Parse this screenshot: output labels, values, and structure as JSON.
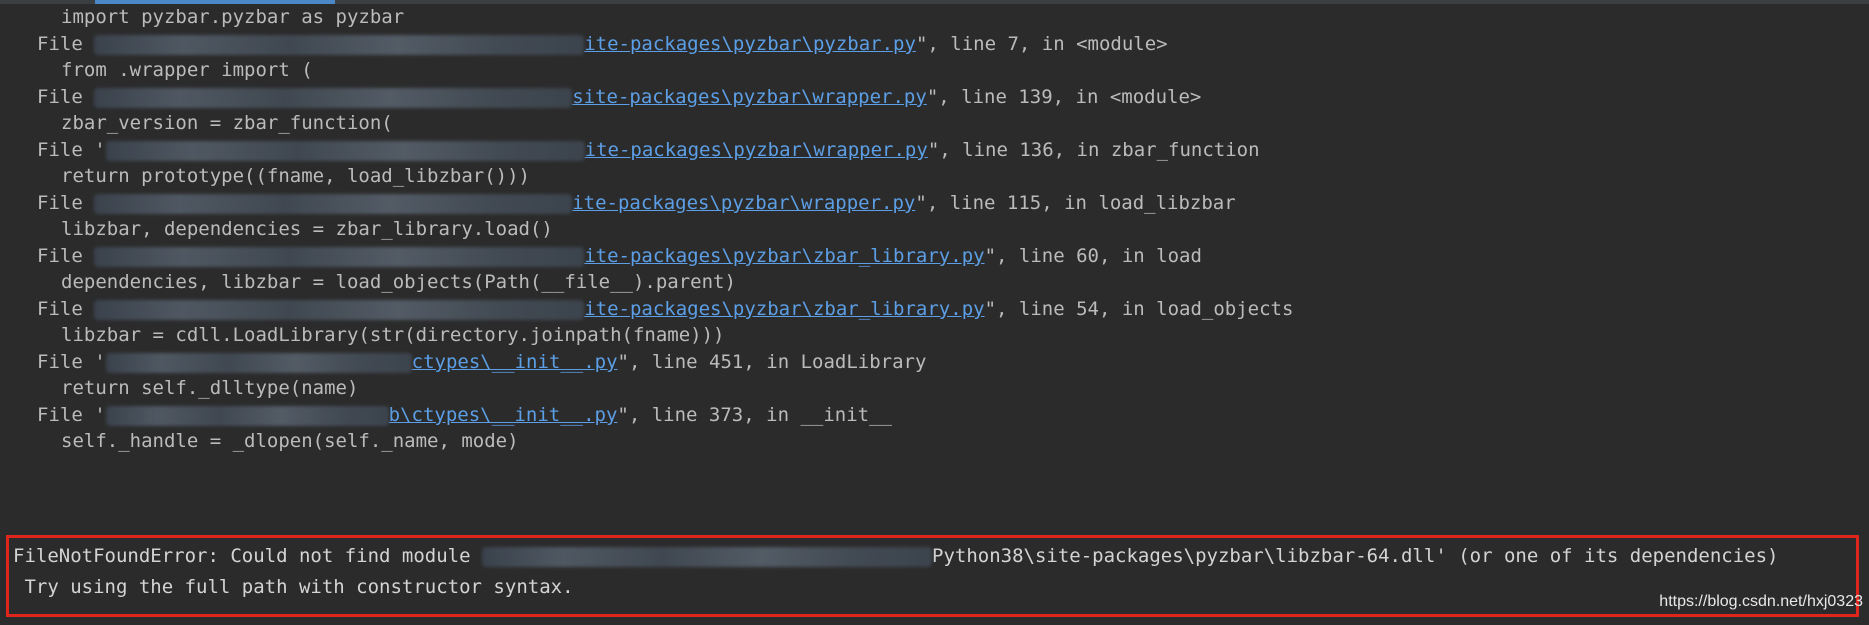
{
  "traceback": {
    "lines": [
      {
        "kind": "code",
        "text": "import pyzbar.pyzbar as pyzbar"
      },
      {
        "kind": "file",
        "prefix": "File ",
        "link": "ite-packages\\pyzbar\\pyzbar.py",
        "suffix": "\", line 7, in <module>"
      },
      {
        "kind": "code",
        "text": "from .wrapper import ("
      },
      {
        "kind": "file",
        "prefix": "File ",
        "link": "site-packages\\pyzbar\\wrapper.py",
        "suffix": "\", line 139, in <module>"
      },
      {
        "kind": "code",
        "text": "zbar_version = zbar_function("
      },
      {
        "kind": "file",
        "prefix": "File '",
        "link": "ite-packages\\pyzbar\\wrapper.py",
        "suffix": "\", line 136, in zbar_function"
      },
      {
        "kind": "code",
        "text": "return prototype((fname, load_libzbar()))"
      },
      {
        "kind": "file",
        "prefix": "File ",
        "link": "ite-packages\\pyzbar\\wrapper.py",
        "suffix": "\", line 115, in load_libzbar"
      },
      {
        "kind": "code",
        "text": "libzbar, dependencies = zbar_library.load()"
      },
      {
        "kind": "file",
        "prefix": "File ",
        "link": "ite-packages\\pyzbar\\zbar_library.py",
        "suffix": "\", line 60, in load"
      },
      {
        "kind": "code",
        "text": "dependencies, libzbar = load_objects(Path(__file__).parent)"
      },
      {
        "kind": "file",
        "prefix": "File ",
        "link": "ite-packages\\pyzbar\\zbar_library.py",
        "suffix": "\", line 54, in load_objects"
      },
      {
        "kind": "code",
        "text": "libzbar = cdll.LoadLibrary(str(directory.joinpath(fname)))"
      },
      {
        "kind": "file",
        "prefix": "File '",
        "link": "ctypes\\__init__.py",
        "suffix": "\", line 451, in LoadLibrary"
      },
      {
        "kind": "code",
        "text": "return self._dlltype(name)"
      },
      {
        "kind": "file",
        "prefix": "File '",
        "link": "b\\ctypes\\__init__.py",
        "suffix": "\", line 373, in __init__"
      },
      {
        "kind": "code",
        "text": "self._handle = _dlopen(self._name, mode)"
      }
    ]
  },
  "error": {
    "line1_prefix": "FileNotFoundError: Could not find module ",
    "line1_suffix": "Python38\\site-packages\\pyzbar\\libzbar-64.dll' (or one of its dependencies)",
    "line2": " Try using the full path with constructor syntax."
  },
  "watermark": "https://blog.csdn.net/hxj0323",
  "colors": {
    "background": "#2b2b2b",
    "text": "#bbbbbb",
    "link": "#5c9fe6",
    "highlight_border": "#e0251c"
  }
}
